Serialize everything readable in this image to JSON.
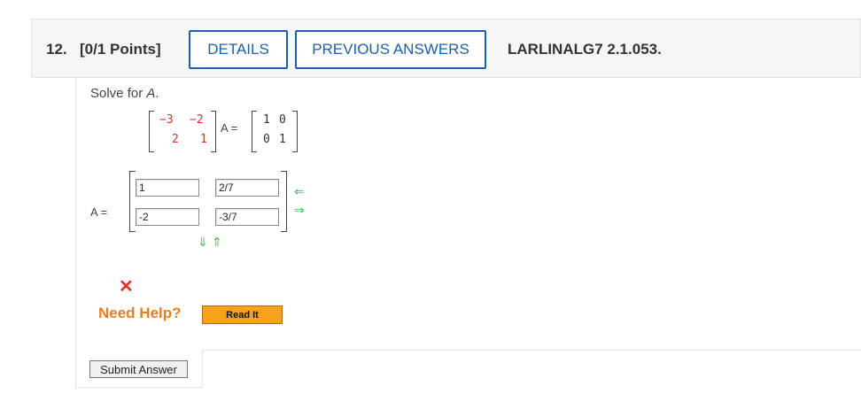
{
  "header": {
    "question_number": "12.",
    "points": "[0/1 Points]",
    "details_label": "DETAILS",
    "previous_answers_label": "PREVIOUS ANSWERS",
    "assignment_code": "LARLINALG7 2.1.053."
  },
  "problem": {
    "prompt_prefix": "Solve for ",
    "prompt_var": "A",
    "prompt_suffix": ".",
    "matrix_left": [
      [
        "−3",
        "−2"
      ],
      [
        "2",
        "1"
      ]
    ],
    "a_eq_text": "A =",
    "matrix_right": [
      [
        "1",
        "0"
      ],
      [
        "0",
        "1"
      ]
    ]
  },
  "answer": {
    "label": "A =",
    "cells": [
      [
        "1",
        "2/7"
      ],
      [
        "-2",
        "-3/7"
      ]
    ]
  },
  "status": {
    "incorrect": true
  },
  "help": {
    "need_help_label": "Need Help?",
    "read_it_label": "Read It"
  },
  "submit_label": "Submit Answer",
  "colors": {
    "accent_blue": "#1f5fa8",
    "help_orange": "#e67e22",
    "incorrect_red": "#e03131",
    "arrow_green": "#4caf50"
  }
}
